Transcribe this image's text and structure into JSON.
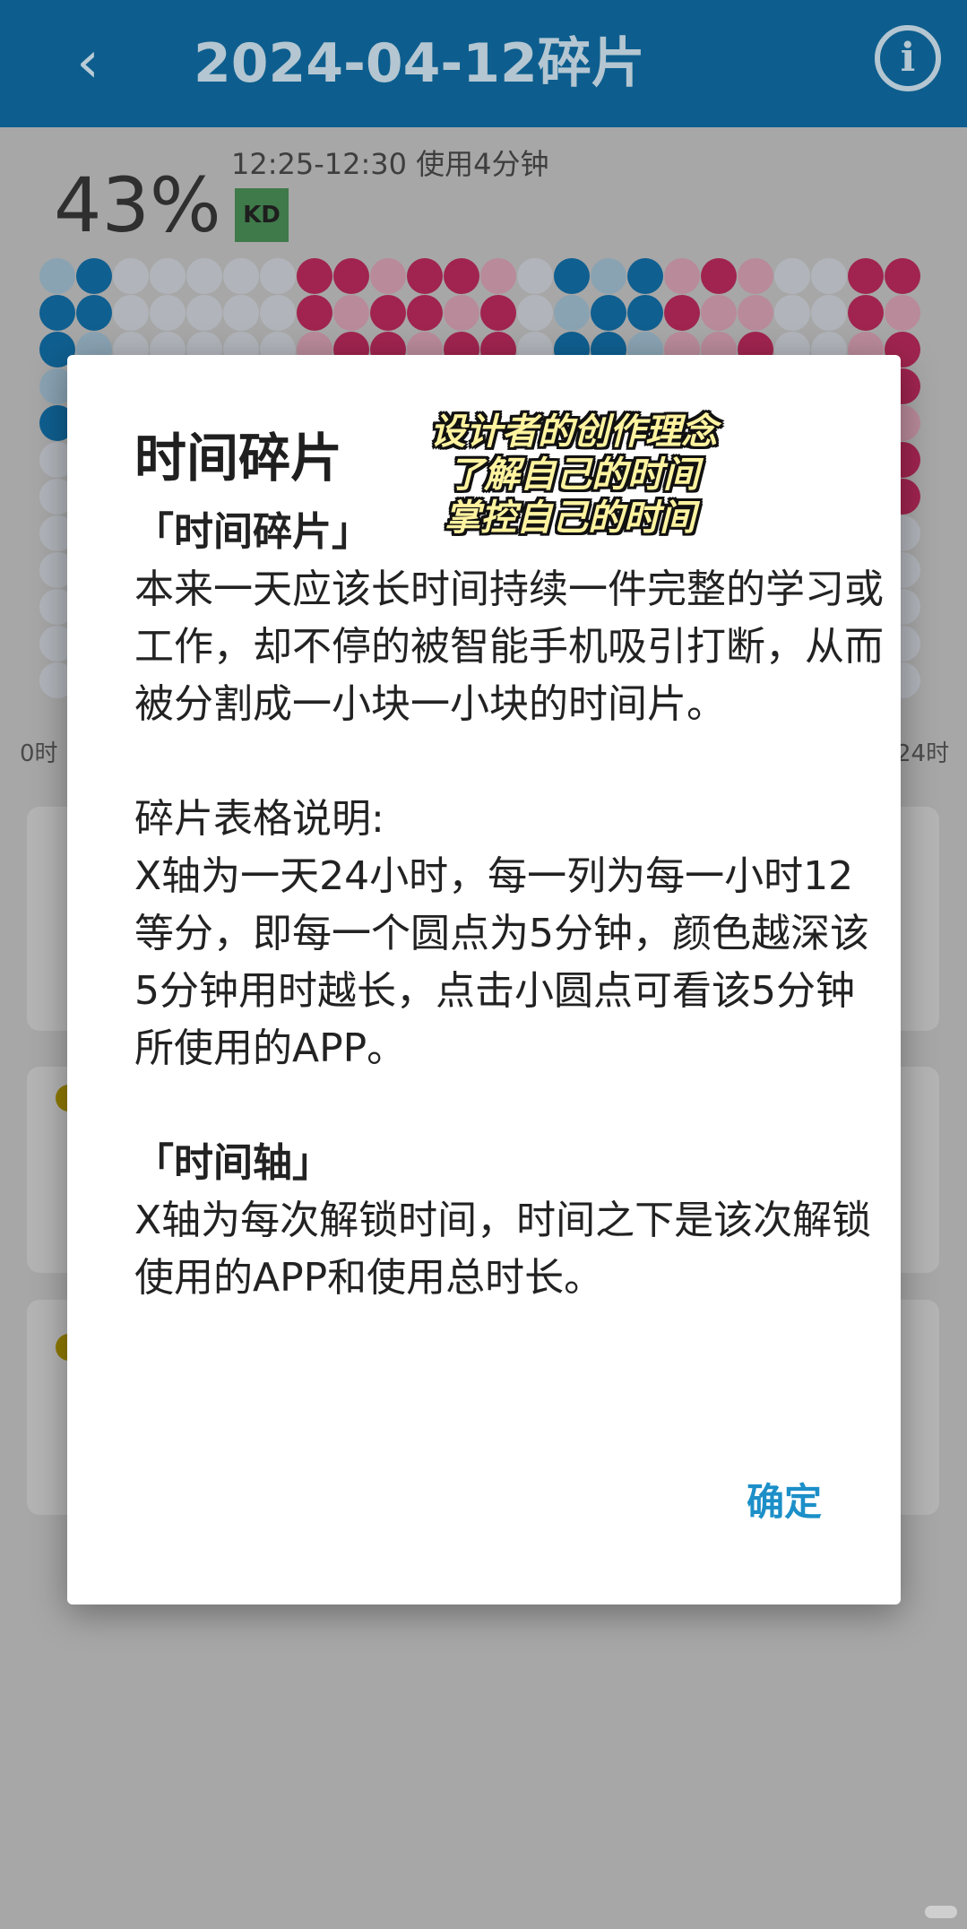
{
  "appbar": {
    "title": "2024-04-12碎片",
    "back_icon": "chevron-left-icon",
    "info_icon": "info-icon",
    "info_glyph": "i"
  },
  "summary": {
    "percent": "43%",
    "time_range": "12:25-12:30 使用4分钟",
    "app_badge": "KD"
  },
  "axis": {
    "start": "0时",
    "end": "24时"
  },
  "dialog": {
    "title": "时间碎片",
    "caption_lines": [
      "设计者的创作理念",
      "了解自己的时间",
      "掌控自己的时间"
    ],
    "section1_heading": "「时间碎片」",
    "section1_text": "本来一天应该长时间持续一件完整的学习或工作，却不停的被智能手机吸引打断，从而被分割成一小块一小块的时间片。",
    "section2_heading": "碎片表格说明:",
    "section2_text": "X轴为一天24小时，每一列为每一小时12等分，即每一个圆点为5分钟，颜色越深该5分钟用时越长，点击小圆点可看该5分钟所使用的APP。",
    "section3_heading": "「时间轴」",
    "section3_text": "X轴为每次解锁时间，时间之下是该次解锁使用的APP和使用总时长。",
    "ok_label": "确定"
  },
  "colors": {
    "appbar": "#0d5e8e",
    "dot_blue": "#0f5f90",
    "dot_blue_light": "#8aa3b3",
    "dot_pink": "#a0244f",
    "dot_pink_light": "#b98a9a",
    "dot_empty": "#b1b5bb",
    "accent": "#1c8fc8"
  }
}
